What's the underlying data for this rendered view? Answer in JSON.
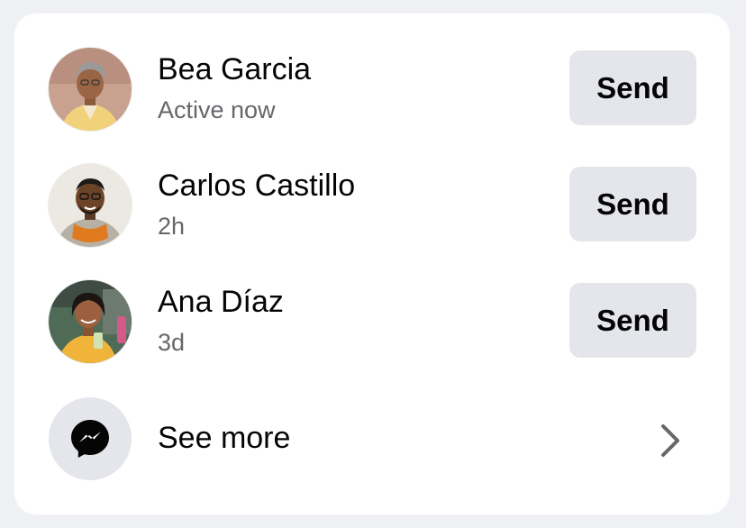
{
  "contacts": [
    {
      "name": "Bea Garcia",
      "status": "Active now",
      "action_label": "Send"
    },
    {
      "name": "Carlos Castillo",
      "status": "2h",
      "action_label": "Send"
    },
    {
      "name": "Ana Díaz",
      "status": "3d",
      "action_label": "Send"
    }
  ],
  "see_more": {
    "label": "See more",
    "icon": "messenger-icon"
  },
  "colors": {
    "background": "#eef0f4",
    "card": "#ffffff",
    "button": "#e4e6eb",
    "primary_text": "#050505",
    "secondary_text": "#65676b"
  }
}
